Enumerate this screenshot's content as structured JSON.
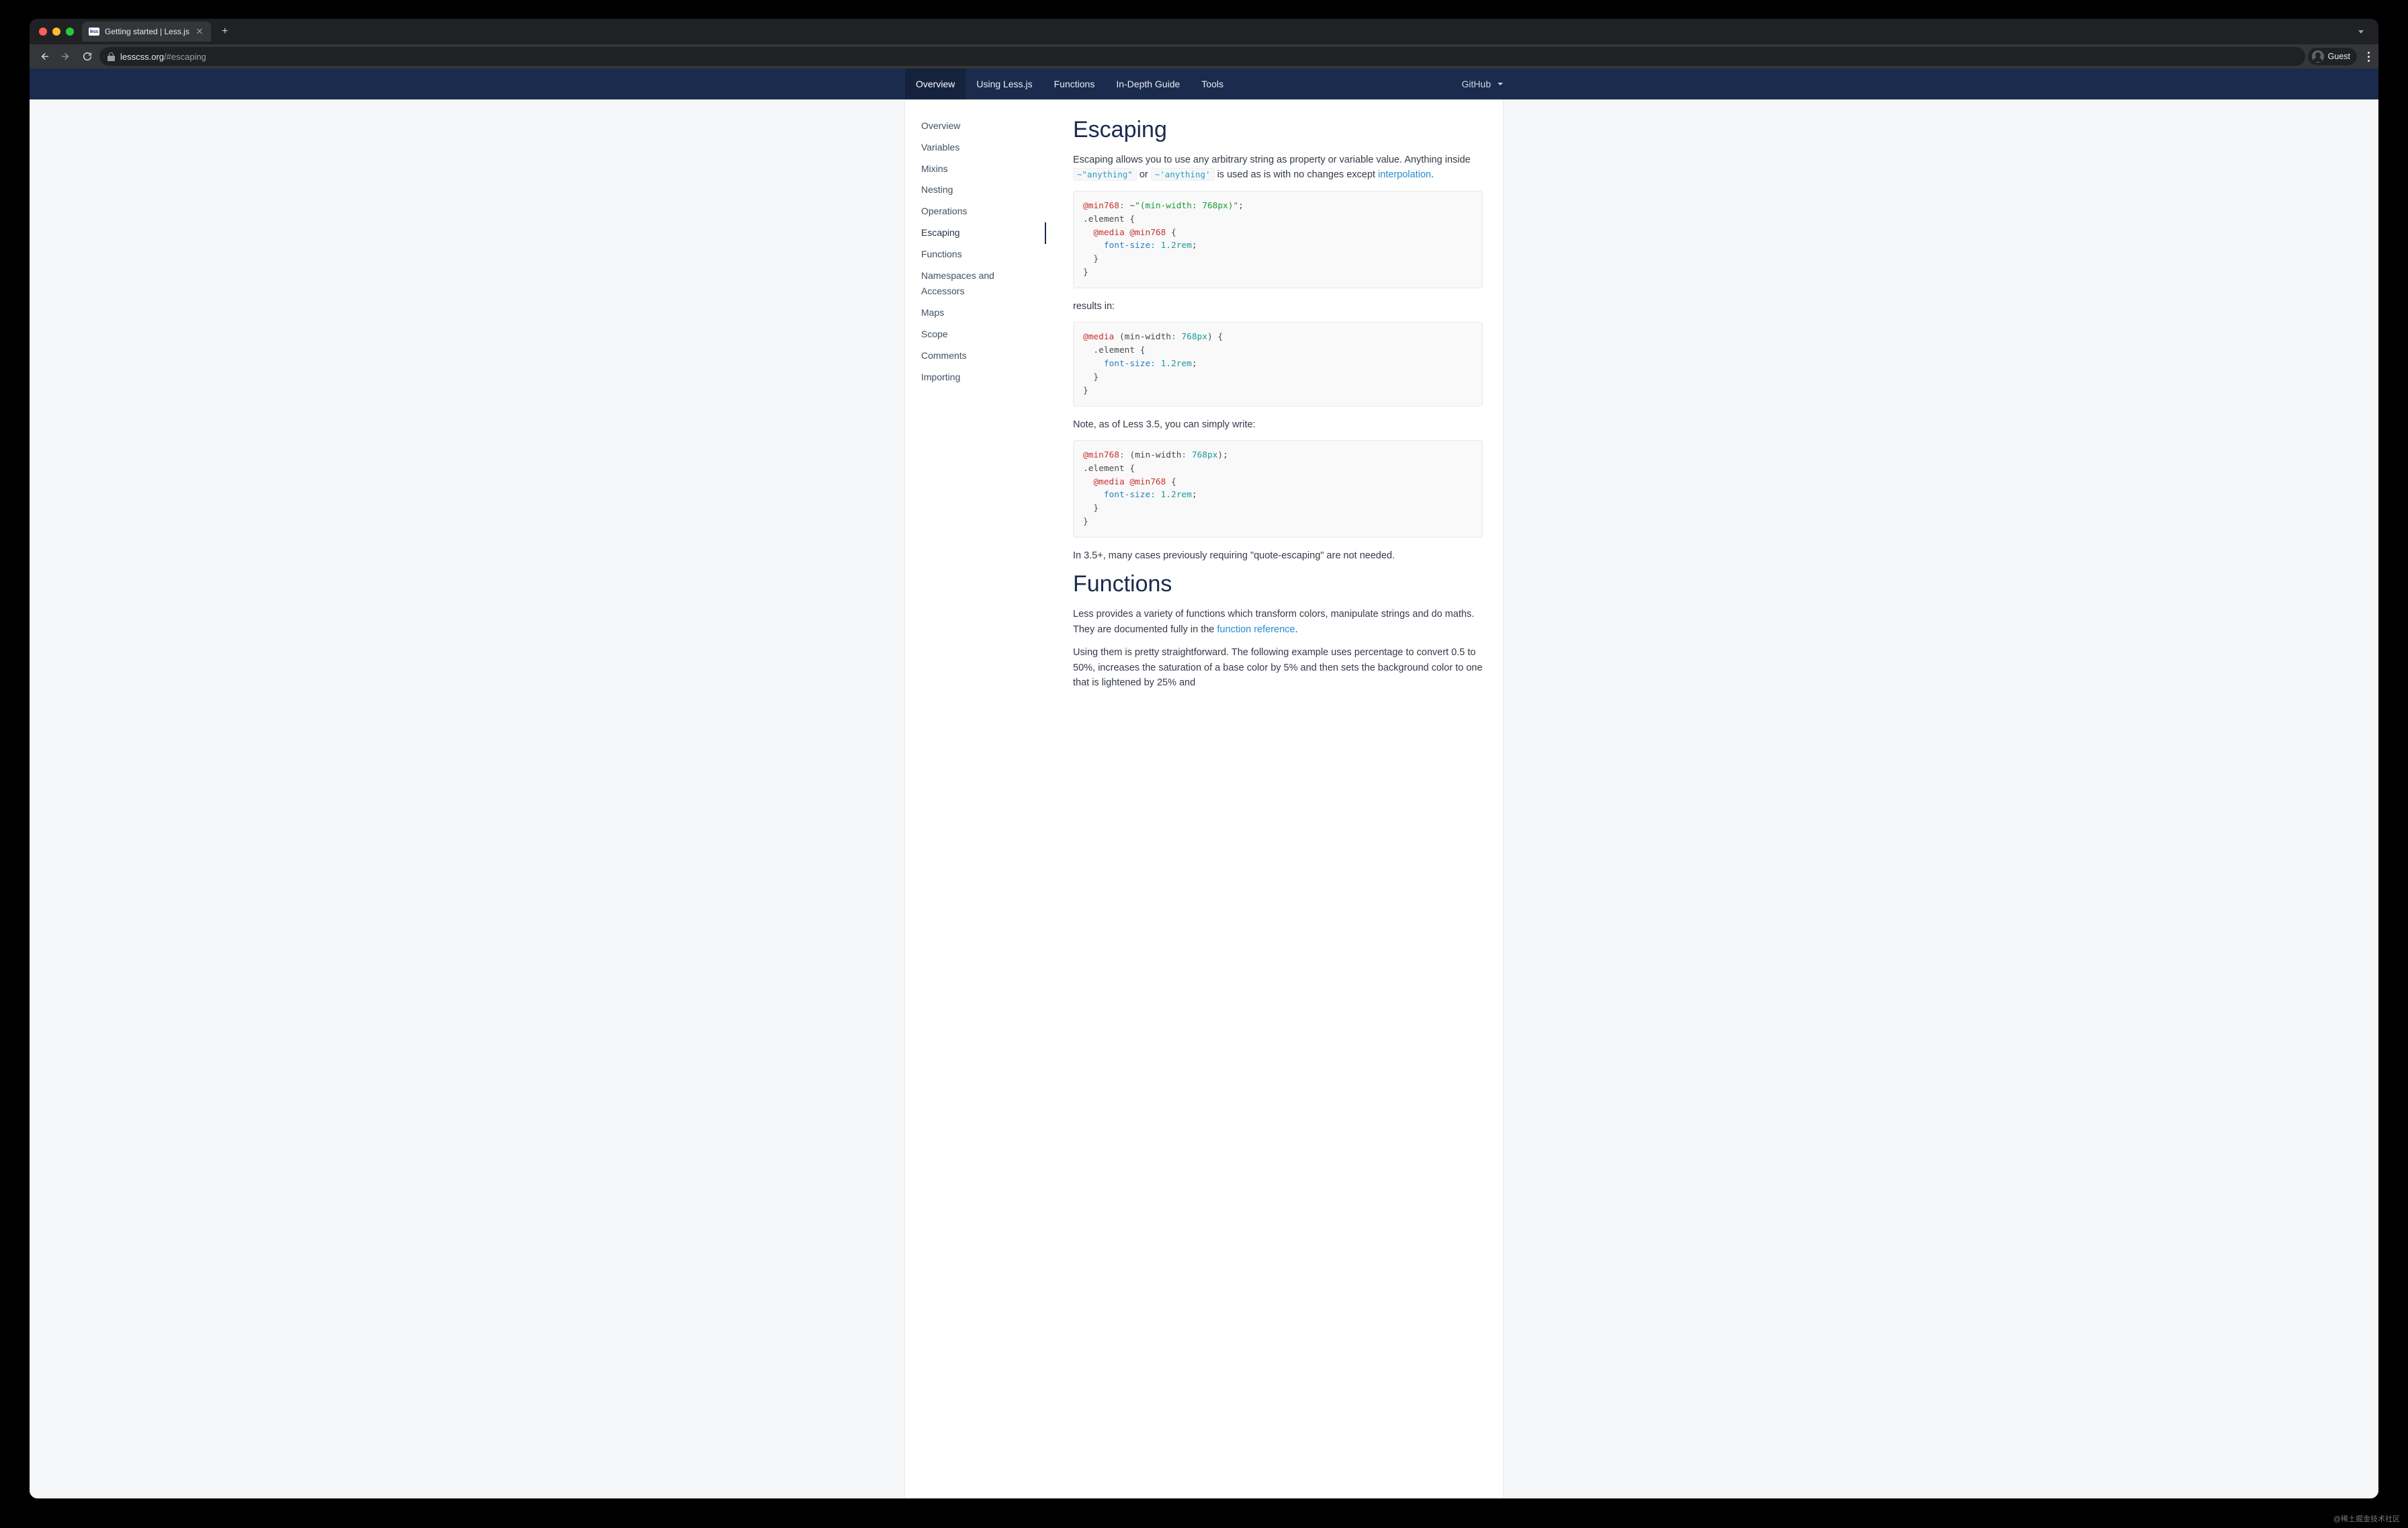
{
  "browser": {
    "tab": {
      "favicon": "less",
      "title": "Getting started | Less.js"
    },
    "url": {
      "host": "lesscss.org",
      "path": "/#escaping"
    },
    "guest_label": "Guest"
  },
  "navbar": {
    "items": [
      {
        "label": "Overview",
        "active": true
      },
      {
        "label": "Using Less.js",
        "active": false
      },
      {
        "label": "Functions",
        "active": false
      },
      {
        "label": "In-Depth Guide",
        "active": false
      },
      {
        "label": "Tools",
        "active": false
      }
    ],
    "right": {
      "label": "GitHub"
    }
  },
  "sidebar": {
    "items": [
      {
        "label": "Overview",
        "active": false
      },
      {
        "label": "Variables",
        "active": false
      },
      {
        "label": "Mixins",
        "active": false
      },
      {
        "label": "Nesting",
        "active": false
      },
      {
        "label": "Operations",
        "active": false
      },
      {
        "label": "Escaping",
        "active": true
      },
      {
        "label": "Functions",
        "active": false
      },
      {
        "label": "Namespaces and Accessors",
        "active": false
      },
      {
        "label": "Maps",
        "active": false
      },
      {
        "label": "Scope",
        "active": false
      },
      {
        "label": "Comments",
        "active": false
      },
      {
        "label": "Importing",
        "active": false
      }
    ]
  },
  "sections": {
    "escaping": {
      "heading": "Escaping",
      "intro_pre": "Escaping allows you to use any arbitrary string as property or variable value. Anything inside ",
      "code1": "~\"anything\"",
      "intro_or": " or ",
      "code2": "~'anything'",
      "intro_post": " is used as is with no changes except ",
      "link1": "interpolation",
      "intro_end": ".",
      "code_block_1": [
        {
          "t": "var",
          "v": "@min768"
        },
        {
          "t": "colon",
          "v": ": "
        },
        {
          "t": "punct",
          "v": "~"
        },
        {
          "t": "str",
          "v": "\"(min-width: 768px)\""
        },
        {
          "t": "punct",
          "v": ";"
        },
        {
          "t": "nl"
        },
        {
          "t": "sel",
          "v": ".element "
        },
        {
          "t": "punct",
          "v": "{"
        },
        {
          "t": "nl"
        },
        {
          "t": "pad",
          "v": "  "
        },
        {
          "t": "at",
          "v": "@media"
        },
        {
          "t": "punct",
          "v": " "
        },
        {
          "t": "var",
          "v": "@min768"
        },
        {
          "t": "punct",
          "v": " {"
        },
        {
          "t": "nl"
        },
        {
          "t": "pad",
          "v": "    "
        },
        {
          "t": "prop",
          "v": "font-size"
        },
        {
          "t": "colon",
          "v": ": "
        },
        {
          "t": "num",
          "v": "1.2rem"
        },
        {
          "t": "punct",
          "v": ";"
        },
        {
          "t": "nl"
        },
        {
          "t": "pad",
          "v": "  "
        },
        {
          "t": "punct",
          "v": "}"
        },
        {
          "t": "nl"
        },
        {
          "t": "punct",
          "v": "}"
        }
      ],
      "results_label": "results in:",
      "code_block_2": [
        {
          "t": "at",
          "v": "@media"
        },
        {
          "t": "punct",
          "v": " ("
        },
        {
          "t": "sel",
          "v": "min-width"
        },
        {
          "t": "colon",
          "v": ": "
        },
        {
          "t": "num",
          "v": "768px"
        },
        {
          "t": "punct",
          "v": ") {"
        },
        {
          "t": "nl"
        },
        {
          "t": "pad",
          "v": "  "
        },
        {
          "t": "sel",
          "v": ".element "
        },
        {
          "t": "punct",
          "v": "{"
        },
        {
          "t": "nl"
        },
        {
          "t": "pad",
          "v": "    "
        },
        {
          "t": "prop",
          "v": "font-size"
        },
        {
          "t": "colon",
          "v": ": "
        },
        {
          "t": "num",
          "v": "1.2rem"
        },
        {
          "t": "punct",
          "v": ";"
        },
        {
          "t": "nl"
        },
        {
          "t": "pad",
          "v": "  "
        },
        {
          "t": "punct",
          "v": "}"
        },
        {
          "t": "nl"
        },
        {
          "t": "punct",
          "v": "}"
        }
      ],
      "note1": "Note, as of Less 3.5, you can simply write:",
      "code_block_3": [
        {
          "t": "var",
          "v": "@min768"
        },
        {
          "t": "colon",
          "v": ": "
        },
        {
          "t": "punct",
          "v": "("
        },
        {
          "t": "sel",
          "v": "min-width"
        },
        {
          "t": "colon",
          "v": ": "
        },
        {
          "t": "num",
          "v": "768px"
        },
        {
          "t": "punct",
          "v": ");"
        },
        {
          "t": "nl"
        },
        {
          "t": "sel",
          "v": ".element "
        },
        {
          "t": "punct",
          "v": "{"
        },
        {
          "t": "nl"
        },
        {
          "t": "pad",
          "v": "  "
        },
        {
          "t": "at",
          "v": "@media"
        },
        {
          "t": "punct",
          "v": " "
        },
        {
          "t": "var",
          "v": "@min768"
        },
        {
          "t": "punct",
          "v": " {"
        },
        {
          "t": "nl"
        },
        {
          "t": "pad",
          "v": "    "
        },
        {
          "t": "prop",
          "v": "font-size"
        },
        {
          "t": "colon",
          "v": ": "
        },
        {
          "t": "num",
          "v": "1.2rem"
        },
        {
          "t": "punct",
          "v": ";"
        },
        {
          "t": "nl"
        },
        {
          "t": "pad",
          "v": "  "
        },
        {
          "t": "punct",
          "v": "}"
        },
        {
          "t": "nl"
        },
        {
          "t": "punct",
          "v": "}"
        }
      ],
      "note2": "In 3.5+, many cases previously requiring \"quote-escaping\" are not needed."
    },
    "functions": {
      "heading": "Functions",
      "p1_pre": "Less provides a variety of functions which transform colors, manipulate strings and do maths. They are documented fully in the ",
      "p1_link": "function reference",
      "p1_post": ".",
      "p2": "Using them is pretty straightforward. The following example uses percentage to convert 0.5 to 50%, increases the saturation of a base color by 5% and then sets the background color to one that is lightened by 25% and"
    }
  },
  "watermark": "@稀土掘金技术社区"
}
